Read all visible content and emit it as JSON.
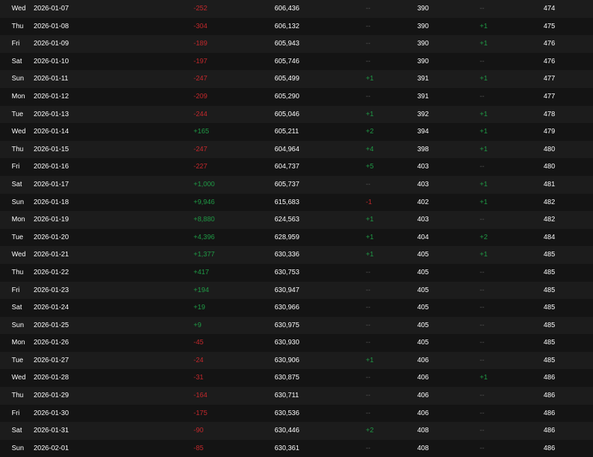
{
  "colors": {
    "negative": "#c4282c",
    "positive": "#1f9a45",
    "neutral": "#555555",
    "text": "#ffffff",
    "row_odd": "#1c1c1c",
    "row_even": "#141414"
  },
  "rows": [
    {
      "day": "Wed",
      "date": "2026-01-07",
      "delta": "-252",
      "total": "606,436",
      "d2": "--",
      "v2": "390",
      "d3": "--",
      "v3": "474"
    },
    {
      "day": "Thu",
      "date": "2026-01-08",
      "delta": "-304",
      "total": "606,132",
      "d2": "--",
      "v2": "390",
      "d3": "+1",
      "v3": "475"
    },
    {
      "day": "Fri",
      "date": "2026-01-09",
      "delta": "-189",
      "total": "605,943",
      "d2": "--",
      "v2": "390",
      "d3": "+1",
      "v3": "476"
    },
    {
      "day": "Sat",
      "date": "2026-01-10",
      "delta": "-197",
      "total": "605,746",
      "d2": "--",
      "v2": "390",
      "d3": "--",
      "v3": "476"
    },
    {
      "day": "Sun",
      "date": "2026-01-11",
      "delta": "-247",
      "total": "605,499",
      "d2": "+1",
      "v2": "391",
      "d3": "+1",
      "v3": "477"
    },
    {
      "day": "Mon",
      "date": "2026-01-12",
      "delta": "-209",
      "total": "605,290",
      "d2": "--",
      "v2": "391",
      "d3": "--",
      "v3": "477"
    },
    {
      "day": "Tue",
      "date": "2026-01-13",
      "delta": "-244",
      "total": "605,046",
      "d2": "+1",
      "v2": "392",
      "d3": "+1",
      "v3": "478"
    },
    {
      "day": "Wed",
      "date": "2026-01-14",
      "delta": "+165",
      "total": "605,211",
      "d2": "+2",
      "v2": "394",
      "d3": "+1",
      "v3": "479"
    },
    {
      "day": "Thu",
      "date": "2026-01-15",
      "delta": "-247",
      "total": "604,964",
      "d2": "+4",
      "v2": "398",
      "d3": "+1",
      "v3": "480"
    },
    {
      "day": "Fri",
      "date": "2026-01-16",
      "delta": "-227",
      "total": "604,737",
      "d2": "+5",
      "v2": "403",
      "d3": "--",
      "v3": "480"
    },
    {
      "day": "Sat",
      "date": "2026-01-17",
      "delta": "+1,000",
      "total": "605,737",
      "d2": "--",
      "v2": "403",
      "d3": "+1",
      "v3": "481"
    },
    {
      "day": "Sun",
      "date": "2026-01-18",
      "delta": "+9,946",
      "total": "615,683",
      "d2": "-1",
      "v2": "402",
      "d3": "+1",
      "v3": "482"
    },
    {
      "day": "Mon",
      "date": "2026-01-19",
      "delta": "+8,880",
      "total": "624,563",
      "d2": "+1",
      "v2": "403",
      "d3": "--",
      "v3": "482"
    },
    {
      "day": "Tue",
      "date": "2026-01-20",
      "delta": "+4,396",
      "total": "628,959",
      "d2": "+1",
      "v2": "404",
      "d3": "+2",
      "v3": "484"
    },
    {
      "day": "Wed",
      "date": "2026-01-21",
      "delta": "+1,377",
      "total": "630,336",
      "d2": "+1",
      "v2": "405",
      "d3": "+1",
      "v3": "485"
    },
    {
      "day": "Thu",
      "date": "2026-01-22",
      "delta": "+417",
      "total": "630,753",
      "d2": "--",
      "v2": "405",
      "d3": "--",
      "v3": "485"
    },
    {
      "day": "Fri",
      "date": "2026-01-23",
      "delta": "+194",
      "total": "630,947",
      "d2": "--",
      "v2": "405",
      "d3": "--",
      "v3": "485"
    },
    {
      "day": "Sat",
      "date": "2026-01-24",
      "delta": "+19",
      "total": "630,966",
      "d2": "--",
      "v2": "405",
      "d3": "--",
      "v3": "485"
    },
    {
      "day": "Sun",
      "date": "2026-01-25",
      "delta": "+9",
      "total": "630,975",
      "d2": "--",
      "v2": "405",
      "d3": "--",
      "v3": "485"
    },
    {
      "day": "Mon",
      "date": "2026-01-26",
      "delta": "-45",
      "total": "630,930",
      "d2": "--",
      "v2": "405",
      "d3": "--",
      "v3": "485"
    },
    {
      "day": "Tue",
      "date": "2026-01-27",
      "delta": "-24",
      "total": "630,906",
      "d2": "+1",
      "v2": "406",
      "d3": "--",
      "v3": "485"
    },
    {
      "day": "Wed",
      "date": "2026-01-28",
      "delta": "-31",
      "total": "630,875",
      "d2": "--",
      "v2": "406",
      "d3": "+1",
      "v3": "486"
    },
    {
      "day": "Thu",
      "date": "2026-01-29",
      "delta": "-164",
      "total": "630,711",
      "d2": "--",
      "v2": "406",
      "d3": "--",
      "v3": "486"
    },
    {
      "day": "Fri",
      "date": "2026-01-30",
      "delta": "-175",
      "total": "630,536",
      "d2": "--",
      "v2": "406",
      "d3": "--",
      "v3": "486"
    },
    {
      "day": "Sat",
      "date": "2026-01-31",
      "delta": "-90",
      "total": "630,446",
      "d2": "+2",
      "v2": "408",
      "d3": "--",
      "v3": "486"
    },
    {
      "day": "Sun",
      "date": "2026-02-01",
      "delta": "-85",
      "total": "630,361",
      "d2": "--",
      "v2": "408",
      "d3": "--",
      "v3": "486"
    }
  ]
}
